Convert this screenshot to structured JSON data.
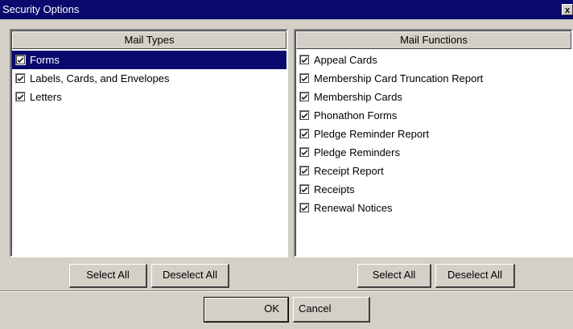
{
  "window": {
    "title": "Security Options",
    "close_glyph": "x"
  },
  "mail_types": {
    "header": "Mail Types",
    "items": [
      {
        "label": "Forms",
        "checked": true,
        "selected": true
      },
      {
        "label": "Labels, Cards, and Envelopes",
        "checked": true,
        "selected": false
      },
      {
        "label": "Letters",
        "checked": true,
        "selected": false
      }
    ],
    "select_all_label": "Select All",
    "deselect_all_label": "Deselect All"
  },
  "mail_functions": {
    "header": "Mail Functions",
    "items": [
      {
        "label": "Appeal Cards",
        "checked": true
      },
      {
        "label": "Membership Card Truncation Report",
        "checked": true
      },
      {
        "label": "Membership Cards",
        "checked": true
      },
      {
        "label": "Phonathon Forms",
        "checked": true
      },
      {
        "label": "Pledge Reminder Report",
        "checked": true
      },
      {
        "label": "Pledge Reminders",
        "checked": true
      },
      {
        "label": "Receipt Report",
        "checked": true
      },
      {
        "label": "Receipts",
        "checked": true
      },
      {
        "label": "Renewal Notices",
        "checked": true
      }
    ],
    "select_all_label": "Select All",
    "deselect_all_label": "Deselect All"
  },
  "dialog_buttons": {
    "ok_label": "OK",
    "cancel_label": "Cancel"
  },
  "colors": {
    "titlebar": "#0a0a6e",
    "face": "#d4d0c8",
    "selection": "#0a0a6e"
  }
}
